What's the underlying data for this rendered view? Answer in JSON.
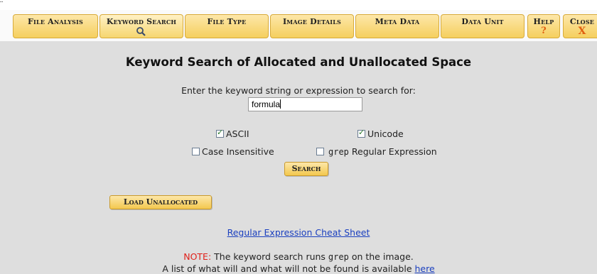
{
  "window": {
    "topline_text": "…"
  },
  "menu": {
    "file_analysis": "File Analysis",
    "keyword_search": "Keyword Search",
    "keyword_search_icon": "magnifier-icon",
    "file_type": "File Type",
    "image_details": "Image Details",
    "meta_data": "Meta Data",
    "data_unit": "Data Unit",
    "help": "Help",
    "help_icon": "?",
    "close": "Close",
    "close_icon": "X",
    "accent_color": "#f5cf5e"
  },
  "page": {
    "title": "Keyword Search of Allocated and Unallocated Space",
    "prompt": "Enter the keyword string or expression to search for:",
    "keyword_value": "formula"
  },
  "options": {
    "ascii": {
      "label": "ASCII",
      "checked": true
    },
    "unicode": {
      "label": "Unicode",
      "checked": true
    },
    "case_insensitive": {
      "label": "Case Insensitive",
      "checked": false
    },
    "grep_regex": {
      "code": "grep",
      "label": "Regular Expression",
      "checked": false
    }
  },
  "buttons": {
    "search": "Search",
    "load_unallocated": "Load Unallocated"
  },
  "links": {
    "cheat_sheet": "Regular Expression Cheat Sheet"
  },
  "note": {
    "prefix": "NOTE:",
    "text_before_code": "The keyword search runs",
    "code": "grep",
    "text_after_code": "on the image.",
    "line2_text": "A list of what will and what will not be found is available",
    "line2_link": "here"
  }
}
